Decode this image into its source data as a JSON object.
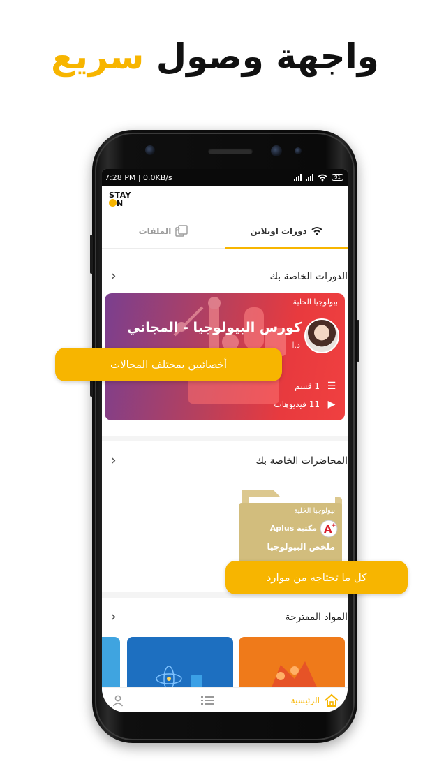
{
  "headline": {
    "part1": "واجهة وصول",
    "part2": "سريع"
  },
  "status_bar": {
    "left": "7:28 PM | 0.0KB/s",
    "battery": "91"
  },
  "logo": {
    "line1": "STAY",
    "line2": "N"
  },
  "tabs": [
    {
      "label": "دورات اونلاين",
      "icon": "wifi-icon",
      "active": true
    },
    {
      "label": "الملفات",
      "icon": "pdf-files-icon",
      "active": false
    }
  ],
  "sections": {
    "courses_title": "الدورات الخاصة بك",
    "lectures_title": "المحاضرات الخاصة بك",
    "materials_title": "المواد المقترحة"
  },
  "course_card": {
    "subject": "بيولوجيا الخلية",
    "title": "كورس البيولوجيا - المجاني",
    "author": "د.ا",
    "sections_count": "1 قسم",
    "videos_count": "11 فيديوهات"
  },
  "lecture_card": {
    "subject": "بيولوجيا الخلية",
    "library": "مكتبة Aplus",
    "title": "ملخص البيولوجيا"
  },
  "bottom_nav": {
    "home_label": "الرئيسية"
  },
  "callouts": {
    "specialists": "أخصائيين بمختلف المجالات",
    "resources": "كل ما تحتاجه من موارد"
  },
  "colors": {
    "accent": "#f7b500",
    "text": "#222222"
  }
}
